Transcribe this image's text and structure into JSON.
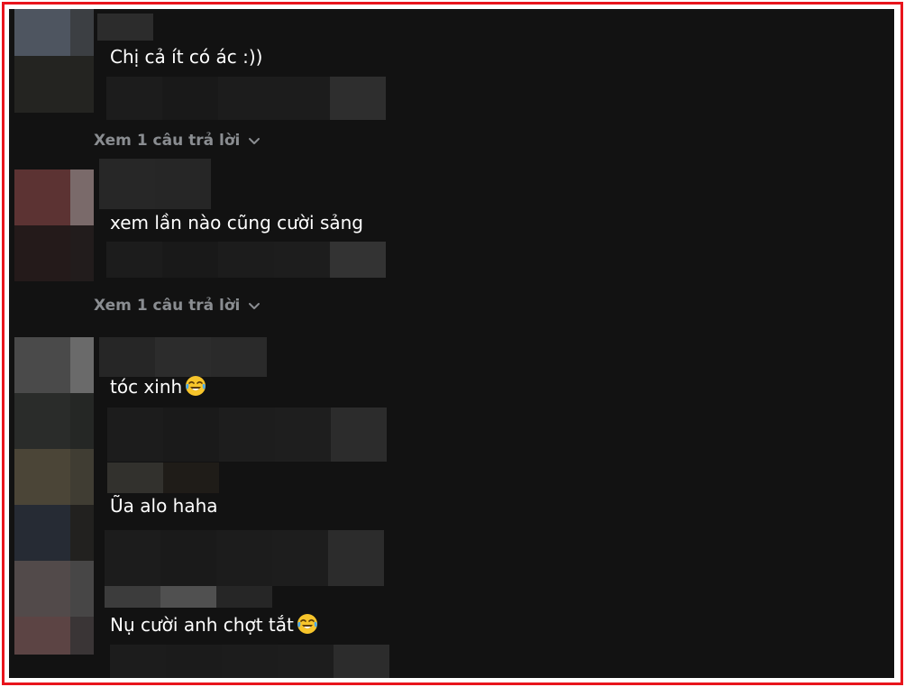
{
  "comments": [
    {
      "text": "Chị cả ít có ác :))"
    },
    {
      "text": "xem lần nào cũng cười sảng"
    },
    {
      "text": "tóc xinh"
    },
    {
      "text": "Ũa alo haha"
    },
    {
      "text": "Nụ cười anh chợt tắt"
    }
  ],
  "reply_links": [
    {
      "label": "Xem 1 câu trả lời"
    },
    {
      "label": "Xem 1 câu trả lời"
    }
  ],
  "icons": {
    "reply_chevron": "chevron-down-icon",
    "emoji": "face-with-tears-of-joy-icon"
  },
  "colors": {
    "background": "#121212",
    "frame_border": "#e8141c",
    "text": "#ffffff",
    "muted": "#8a8d91"
  }
}
